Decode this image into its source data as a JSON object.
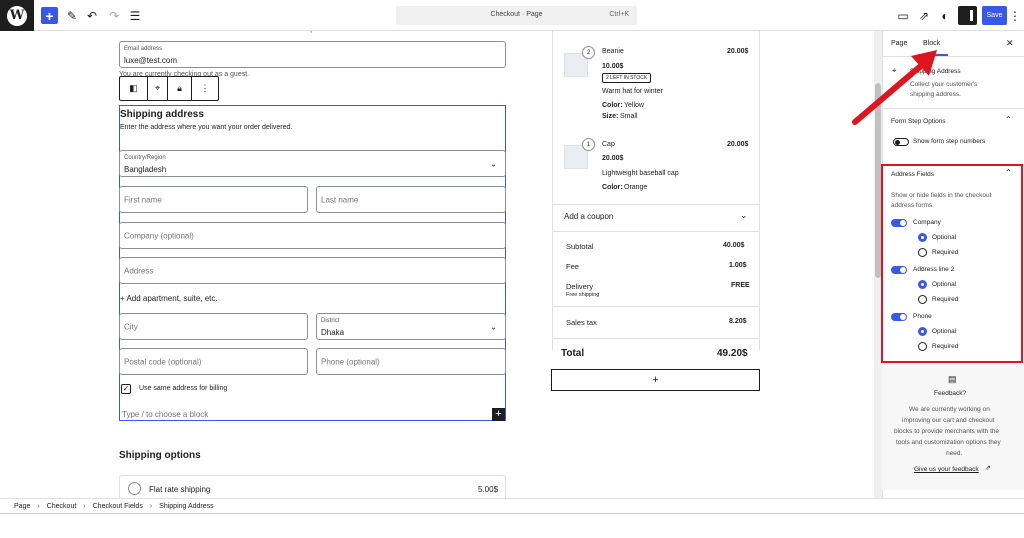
{
  "topbar": {
    "page_title": "Checkout · Page",
    "shortcut": "Ctrl+K",
    "save_label": "Save"
  },
  "canvas": {
    "email_label": "Email address",
    "email_value": "luxe@test.com",
    "guest_note": "You are currently checking out as a guest.",
    "shipping_title": "Shipping address",
    "shipping_desc": "Enter the address where you want your order delivered.",
    "country_label": "Country/Region",
    "country_value": "Bangladesh",
    "first_name_ph": "First name",
    "last_name_ph": "Last name",
    "company_ph": "Company (optional)",
    "address_ph": "Address",
    "add_apartment": "+ Add apartment, suite, etc.",
    "city_ph": "City",
    "district_label": "District",
    "district_value": "Dhaka",
    "postal_ph": "Postal code (optional)",
    "phone_ph": "Phone (optional)",
    "same_billing": "Use same address for billing",
    "choose_block": "Type / to choose a block",
    "shipping_options_title": "Shipping options",
    "flat_rate": "Flat rate shipping",
    "flat_rate_price": "5.00$"
  },
  "order": {
    "items": [
      {
        "qty": "2",
        "name": "Beanie",
        "total": "20.00$",
        "price": "10.00$",
        "badge": "2 left in stock",
        "desc": "Warm hat for winter",
        "color_label": "Color:",
        "color": "Yellow",
        "size_label": "Size:",
        "size": "Small"
      },
      {
        "qty": "1",
        "name": "Cap",
        "total": "20.00$",
        "price": "20.00$",
        "desc": "Lightweight baseball cap",
        "color_label": "Color:",
        "color": "Orange"
      }
    ],
    "coupon": "Add a coupon",
    "subtotal_label": "Subtotal",
    "subtotal": "40.00$",
    "fee_label": "Fee",
    "fee": "1.00$",
    "delivery_label": "Delivery",
    "delivery_sub": "Free shipping",
    "delivery": "FREE",
    "tax_label": "Sales tax",
    "tax": "8.20$",
    "total_label": "Total",
    "total": "49.20$",
    "add_block": "+"
  },
  "sidebar": {
    "tab_page": "Page",
    "tab_block": "Block",
    "block_title": "Shipping Address",
    "block_desc_1": "Collect your customer's",
    "block_desc_2": "shipping address.",
    "form_step_title": "Form Step Options",
    "form_step_toggle": "Show form step numbers",
    "address_fields_title": "Address Fields",
    "address_fields_desc_1": "Show or hide fields in the checkout",
    "address_fields_desc_2": "address forms.",
    "fields": [
      {
        "label": "Company",
        "optional": "Optional",
        "required": "Required"
      },
      {
        "label": "Address line 2",
        "optional": "Optional",
        "required": "Required"
      },
      {
        "label": "Phone",
        "optional": "Optional",
        "required": "Required"
      }
    ],
    "feedback_title": "Feedback?",
    "feedback_lines": [
      "We are currently working on",
      "improving our cart and checkout",
      "blocks to provide merchants with the",
      "tools and customization options they",
      "need."
    ],
    "feedback_link": "Give us your feedback"
  },
  "breadcrumb": [
    "Page",
    "Checkout",
    "Checkout Fields",
    "Shipping Address"
  ],
  "colors": {
    "accent": "#3858e9",
    "annotation_red": "#e0141e"
  }
}
